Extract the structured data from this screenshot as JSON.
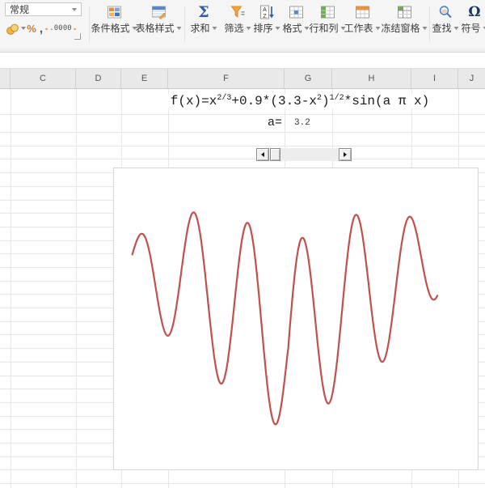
{
  "toolbar": {
    "number_format_value": "常规",
    "glyphs": {
      "sigma": "Σ",
      "omega": "Ω",
      "percent": "%",
      "comma": ",",
      "inc_decimal": ".00",
      "dec_decimal": ".00",
      "sort_a": "A",
      "sort_z": "Z"
    },
    "buttons": [
      {
        "label": "条件格式"
      },
      {
        "label": "表格样式"
      },
      {
        "label": "求和"
      },
      {
        "label": "筛选"
      },
      {
        "label": "排序"
      },
      {
        "label": "格式"
      },
      {
        "label": "行和列"
      },
      {
        "label": "工作表"
      },
      {
        "label": "冻结窗格"
      },
      {
        "label": "查找"
      },
      {
        "label": "符号"
      }
    ]
  },
  "sheet": {
    "visible_columns": [
      "",
      "C",
      "D",
      "E",
      "F",
      "G",
      "H",
      "I",
      "J"
    ],
    "formula": {
      "segments": [
        {
          "t": "f(x)=x"
        },
        {
          "t": "2/3",
          "sup": true
        },
        {
          "t": "+0.9*(3.3-x"
        },
        {
          "t": "2",
          "sup": true
        },
        {
          "t": ")"
        },
        {
          "t": "1/2",
          "sup": true
        },
        {
          "t": "*sin(a π x)"
        }
      ]
    },
    "a_label": "a=",
    "a_value": "3.2"
  },
  "chart_data": {
    "type": "line",
    "title": "",
    "function": "f(x) = x^(2/3) + 0.9*(3.3 - x^2)^(1/2) * sin(a*π*x)",
    "a": 3.2,
    "amp": 0.9,
    "k": 3.3,
    "x_min": -1.8,
    "x_max": 1.72,
    "ylim_depicted": [
      -1.34,
      2.37
    ],
    "line_color": "#c0504d",
    "axes_visible": false,
    "grid": false,
    "legend": false,
    "key_points": {
      "maxima": [
        [
          -1.72,
          1.96
        ],
        [
          -1.09,
          2.37
        ],
        [
          -0.47,
          2.18
        ],
        [
          0.16,
          1.92
        ],
        [
          0.78,
          2.32
        ],
        [
          1.41,
          2.29
        ]
      ],
      "minima": [
        [
          -1.41,
          0.22
        ],
        [
          -0.78,
          -0.63
        ],
        [
          -0.16,
          -1.34
        ],
        [
          0.47,
          -0.98
        ],
        [
          1.09,
          -0.24
        ],
        [
          1.72,
          0.91
        ]
      ]
    }
  }
}
